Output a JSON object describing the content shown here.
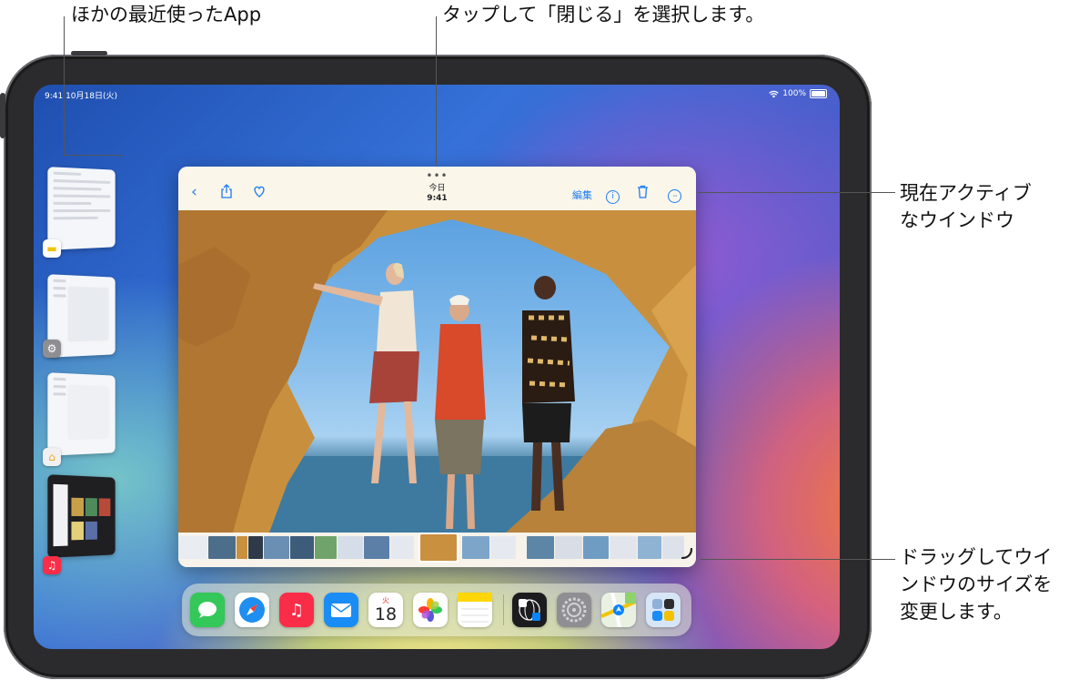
{
  "callouts": {
    "other_apps": "ほかの最近使ったApp",
    "tap_close": "タップして「閉じる」を選択します。",
    "active_window": "現在アクティブ\nなウインドウ",
    "drag_resize": "ドラッグしてウイ\nンドウのサイズを\n変更します。"
  },
  "status": {
    "time_date": "9:41  10月18日(火)",
    "battery": "100%"
  },
  "window": {
    "title": "今日",
    "time": "9:41",
    "edit": "編集",
    "dots": "•••"
  },
  "dock": {
    "calendar_day": "火",
    "calendar_date": "18"
  },
  "icons": {
    "back": "chevron-left-icon",
    "share": "share-icon",
    "heart": "heart-icon",
    "info": "info-icon",
    "trash": "trash-icon",
    "more": "more-icon",
    "wifi": "wifi-icon",
    "battery": "battery-icon",
    "resize": "resize-handle-icon"
  },
  "colors": {
    "accent": "#1a7cf5",
    "toolbar": "#fbf6ea"
  }
}
